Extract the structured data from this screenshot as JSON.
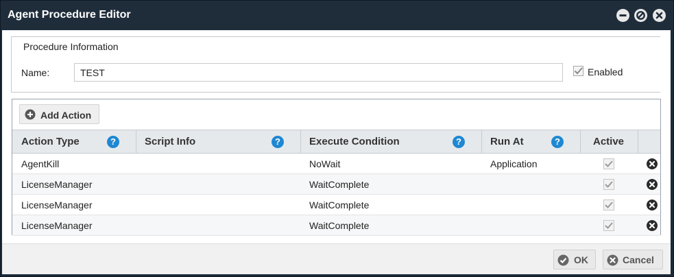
{
  "window": {
    "title": "Agent Procedure Editor",
    "controls": [
      "minimize-icon",
      "restore-icon",
      "close-icon"
    ]
  },
  "procedure_info": {
    "legend": "Procedure Information",
    "name_label": "Name:",
    "name_value": "TEST",
    "enabled_label": "Enabled",
    "enabled_checked": true
  },
  "toolbar": {
    "add_action_label": "Add Action"
  },
  "table": {
    "columns": [
      {
        "label": "Action Type",
        "help": "?"
      },
      {
        "label": "Script Info",
        "help": "?"
      },
      {
        "label": "Execute Condition",
        "help": "?"
      },
      {
        "label": "Run At",
        "help": "?"
      },
      {
        "label": "Active"
      }
    ],
    "rows": [
      {
        "action_type": "AgentKill",
        "script_info": "",
        "execute_condition": "NoWait",
        "run_at": "Application",
        "active": true
      },
      {
        "action_type": "LicenseManager",
        "script_info": "",
        "execute_condition": "WaitComplete",
        "run_at": "",
        "active": true
      },
      {
        "action_type": "LicenseManager",
        "script_info": "",
        "execute_condition": "WaitComplete",
        "run_at": "",
        "active": true
      },
      {
        "action_type": "LicenseManager",
        "script_info": "",
        "execute_condition": "WaitComplete",
        "run_at": "",
        "active": true
      }
    ]
  },
  "footer": {
    "ok_label": "OK",
    "cancel_label": "Cancel"
  },
  "colors": {
    "titlebar": "#1f2d3b",
    "help_icon": "#1e88d2",
    "header_bg": "#e6e9ec"
  }
}
